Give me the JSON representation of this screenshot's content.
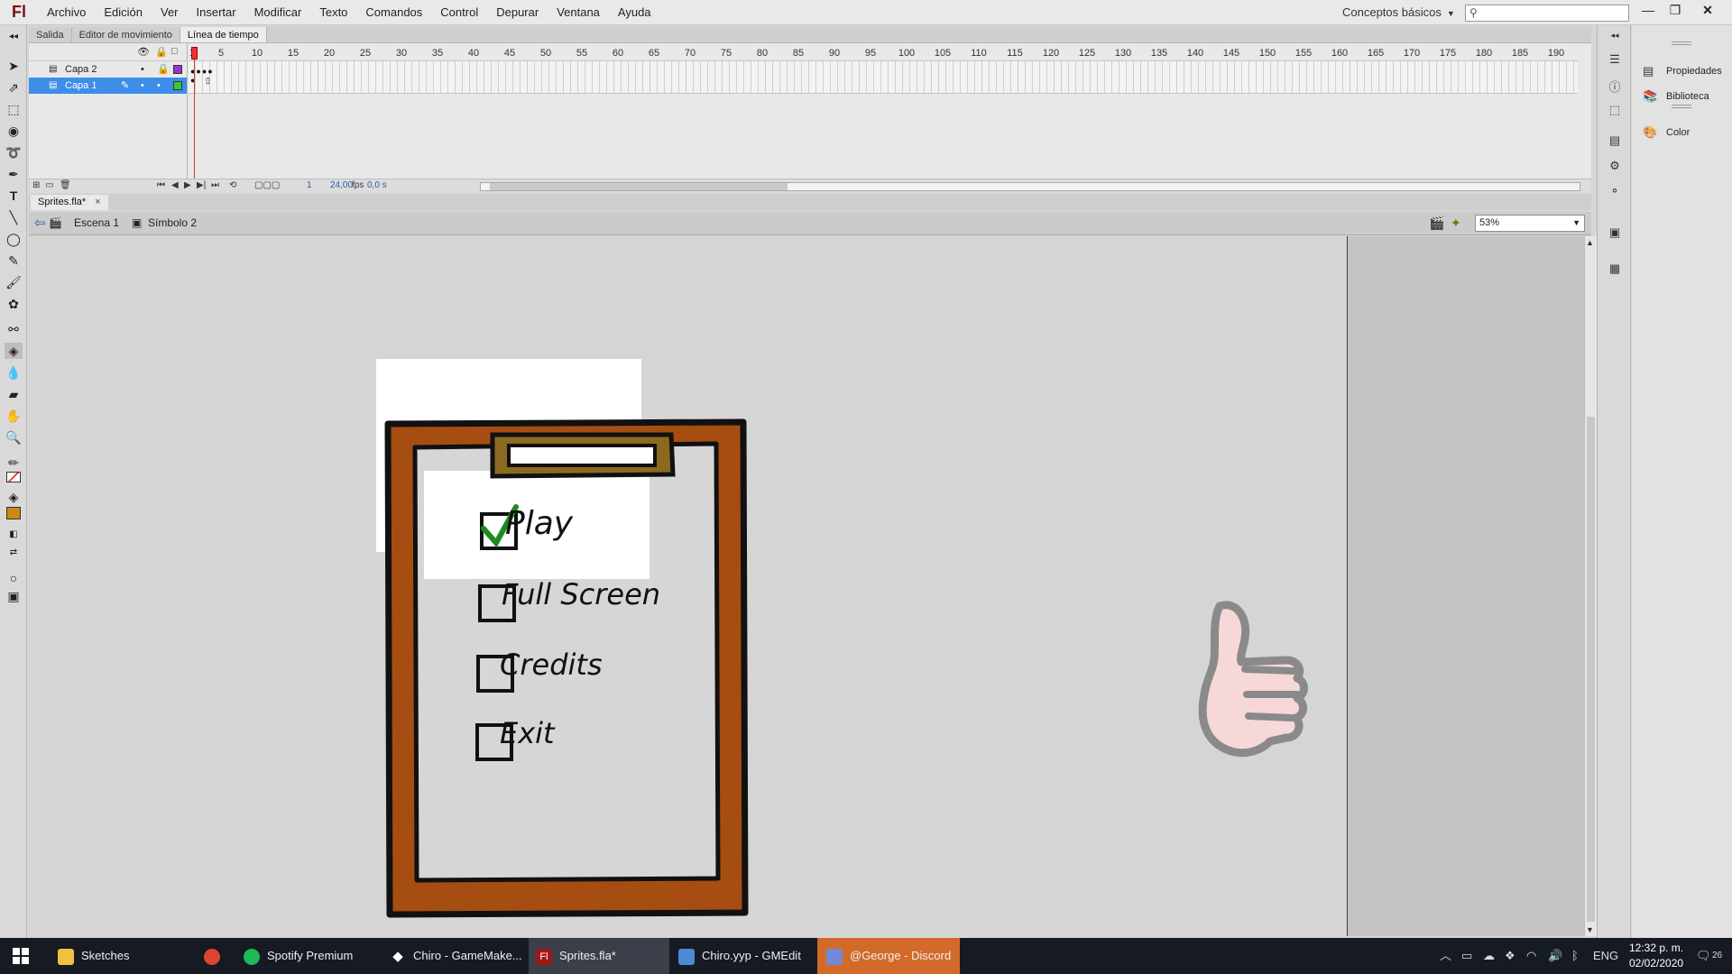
{
  "app": {
    "logo": "Fl"
  },
  "menu": [
    "Archivo",
    "Edición",
    "Ver",
    "Insertar",
    "Modificar",
    "Texto",
    "Comandos",
    "Control",
    "Depurar",
    "Ventana",
    "Ayuda"
  ],
  "workspace": {
    "label": "Conceptos básicos"
  },
  "search": {
    "placeholder": ""
  },
  "panel_tabs": [
    "Salida",
    "Editor de movimiento",
    "Línea de tiempo"
  ],
  "timeline": {
    "layers": [
      {
        "name": "Capa 2",
        "color": "#9933cc",
        "selected": false
      },
      {
        "name": "Capa 1",
        "color": "#33cc33",
        "selected": true
      }
    ],
    "ruler": [
      "1",
      "5",
      "10",
      "15",
      "20",
      "25",
      "30",
      "35",
      "40",
      "45",
      "50",
      "55",
      "60",
      "65",
      "70",
      "75",
      "80",
      "85",
      "90",
      "95",
      "100",
      "105",
      "110",
      "115",
      "120",
      "125",
      "130",
      "135",
      "140",
      "145",
      "150",
      "155",
      "160",
      "165",
      "170",
      "175",
      "180",
      "185",
      "190"
    ],
    "current_frame": "1",
    "fps": "24,00",
    "fps_unit": "fps",
    "time": "0,0 s"
  },
  "document": {
    "tab": "Sprites.fla*",
    "close": "×"
  },
  "breadcrumb": {
    "scene": "Escena 1",
    "symbol": "Símbolo 2"
  },
  "zoom": "53%",
  "stage": {
    "options": [
      "Play",
      "Full Screen",
      "Credits",
      "Exit"
    ],
    "checked": [
      true,
      false,
      false,
      false
    ]
  },
  "right_panels": [
    "Propiedades",
    "Biblioteca",
    "Color"
  ],
  "taskbar": {
    "items": [
      {
        "label": "Sketches",
        "icon_color": "#f0c040"
      },
      {
        "label": "",
        "icon_color": "#dd4433"
      },
      {
        "label": "Spotify Premium",
        "icon_color": "#1db954"
      },
      {
        "label": "Chiro - GameMake...",
        "icon_color": "#ffffff"
      },
      {
        "label": "Sprites.fla*",
        "icon_color": "#a01818"
      },
      {
        "label": "Chiro.yyp - GMEdit",
        "icon_color": "#4a8ad8"
      },
      {
        "label": "@George - Discord",
        "icon_color": "#7289da"
      }
    ],
    "lang": "ENG",
    "time": "12:32 p. m.",
    "date": "02/02/2020",
    "notifications": "26"
  },
  "colors": {
    "clipboard_wood": "#a64d12",
    "check_green": "#1f8a1f",
    "fill_swatch": "#c88a10"
  }
}
